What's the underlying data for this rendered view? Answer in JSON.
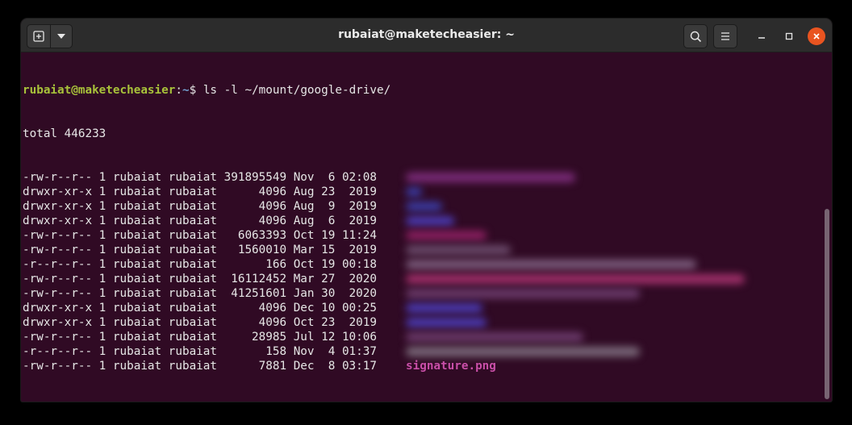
{
  "window": {
    "title": "rubaiat@maketecheasier: ~",
    "icons": {
      "new_tab": "new-tab-icon",
      "menu_down": "chevron-down-icon",
      "search": "search-icon",
      "hamburger": "menu-icon",
      "minimize": "minimize-icon",
      "maximize": "maximize-icon",
      "close": "close-icon"
    },
    "colors": {
      "terminal_bg": "#300a24",
      "titlebar_bg": "#2c2c2c",
      "prompt_user": "#a8c23a",
      "prompt_path": "#729fcf",
      "close_button": "#e95420",
      "file_highlight": "#c94fa8"
    }
  },
  "terminal": {
    "prompt_user": "rubaiat@maketecheasier",
    "prompt_sep": ":",
    "prompt_path": "~",
    "prompt_dollar": "$ ",
    "command": "ls -l ~/mount/google-drive/",
    "total": "total 446233",
    "rows": [
      {
        "meta": "-rw-r--r-- 1 rubaiat rubaiat 391895549 Nov  6 02:08",
        "name": "",
        "blur_color": "#7a2b78",
        "blur_w": 210
      },
      {
        "meta": "drwxr-xr-x 1 rubaiat rubaiat      4096 Aug 23  2019",
        "name": "",
        "blur_color": "#3a3aa0",
        "blur_w": 20
      },
      {
        "meta": "drwxr-xr-x 1 rubaiat rubaiat      4096 Aug  9  2019",
        "name": "",
        "blur_color": "#3a3aa0",
        "blur_w": 45
      },
      {
        "meta": "drwxr-xr-x 1 rubaiat rubaiat      4096 Aug  6  2019",
        "name": "",
        "blur_color": "#4a3ab0",
        "blur_w": 60
      },
      {
        "meta": "-rw-r--r-- 1 rubaiat rubaiat   6063393 Oct 19 11:24",
        "name": "",
        "blur_color": "#8a2060",
        "blur_w": 100
      },
      {
        "meta": "-rw-r--r-- 1 rubaiat rubaiat   1560010 Mar 15  2019",
        "name": "",
        "blur_color": "#6a4a6a",
        "blur_w": 130
      },
      {
        "meta": "-r--r--r-- 1 rubaiat rubaiat       166 Oct 19 00:18",
        "name": "",
        "blur_color": "#7a5a7a",
        "blur_w": 360
      },
      {
        "meta": "-rw-r--r-- 1 rubaiat rubaiat  16112452 Mar 27  2020",
        "name": "",
        "blur_color": "#a0306a",
        "blur_w": 420
      },
      {
        "meta": "-rw-r--r-- 1 rubaiat rubaiat  41251601 Jan 30  2020",
        "name": "",
        "blur_color": "#6a3a6a",
        "blur_w": 290
      },
      {
        "meta": "drwxr-xr-x 1 rubaiat rubaiat      4096 Dec 10 00:25",
        "name": "",
        "blur_color": "#4a3ab0",
        "blur_w": 95
      },
      {
        "meta": "drwxr-xr-x 1 rubaiat rubaiat      4096 Oct 23  2019",
        "name": "",
        "blur_color": "#4a3ab0",
        "blur_w": 100
      },
      {
        "meta": "-rw-r--r-- 1 rubaiat rubaiat     28985 Jul 12 10:06",
        "name": "",
        "blur_color": "#6a3a6a",
        "blur_w": 220
      },
      {
        "meta": "-r--r--r-- 1 rubaiat rubaiat       158 Nov  4 01:37",
        "name": "",
        "blur_color": "#7a6a7a",
        "blur_w": 290
      },
      {
        "meta": "-rw-r--r-- 1 rubaiat rubaiat      7881 Dec  8 03:17",
        "name": "signature.png",
        "blur_color": "",
        "blur_w": 0
      }
    ]
  }
}
